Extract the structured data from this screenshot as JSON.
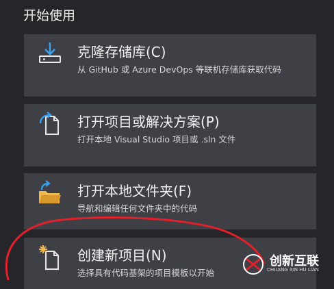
{
  "section_title": "开始使用",
  "cards": [
    {
      "icon": "clone-repository-icon",
      "heading": "克隆存储库(C)",
      "desc": "从 GitHub 或 Azure DevOps 等联机存储库获取代码"
    },
    {
      "icon": "open-project-icon",
      "heading": "打开项目或解决方案(P)",
      "desc": "打开本地 Visual Studio 项目或 .sln 文件"
    },
    {
      "icon": "open-folder-icon",
      "heading": "打开本地文件夹(F)",
      "desc": "导航和编辑任何文件夹中的代码"
    },
    {
      "icon": "new-project-icon",
      "heading": "创建新项目(N)",
      "desc": "选择具有代码基架的项目模板以开始"
    }
  ],
  "watermark": {
    "text": "创新互联",
    "sub": "CHUANG XIN HU LIAN"
  },
  "colors": {
    "background": "#25252a",
    "card": "#3f3f46",
    "accent_blue": "#3aa0f0",
    "folder": "#f0b84e",
    "annotation_red": "#e0202a"
  }
}
